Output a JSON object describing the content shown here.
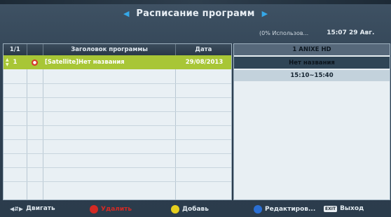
{
  "header": {
    "title": "Расписание программ",
    "left_arrow_icon": "arrow-left-icon",
    "right_arrow_icon": "arrow-right-icon",
    "status_usage": "(0% Использов...",
    "status_datetime": "15:07 29 Авг."
  },
  "table": {
    "columns": [
      "1/1",
      "Заголовок программы",
      "Дата"
    ],
    "rows": [
      {
        "index": "1",
        "type_icon": "record-icon",
        "title": "[Satellite]Нет названия",
        "date": "29/08/2013",
        "selected": true
      }
    ]
  },
  "details": {
    "channel": "1 ANIXE HD",
    "program": "Нет названия",
    "time": "15:10~15:40"
  },
  "footer": {
    "move_label": "Двигать",
    "move_icon": "navigate-arrows-icon",
    "delete_label": "Удалить",
    "add_label": "Добавь",
    "edit_label": "Редактиров...",
    "exit_key": "EXIT",
    "exit_label": "Выход"
  },
  "colors": {
    "red": "#d42a24",
    "yellow": "#e6cf1e",
    "blue": "#2a6fd4",
    "selected_row": "#a8c636",
    "accent_arrow": "#35a8e8"
  }
}
